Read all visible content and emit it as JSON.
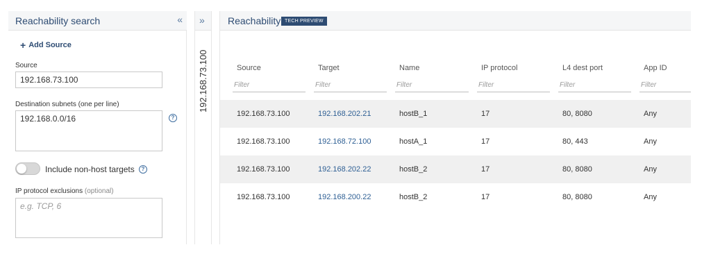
{
  "left_panel": {
    "title": "Reachability search",
    "collapse_icon": "double-chevron-left-icon",
    "add_source_label": "Add Source",
    "source": {
      "label": "Source",
      "value": "192.168.73.100"
    },
    "destination": {
      "label": "Destination subnets (one per line)",
      "value": "192.168.0.0/16"
    },
    "include_non_host": {
      "label": "Include non-host targets",
      "checked": false
    },
    "ip_exclusions": {
      "label": "IP protocol exclusions",
      "optional_label": "(optional)",
      "placeholder": "e.g. TCP, 6"
    }
  },
  "strip": {
    "expand_icon": "double-chevron-right-icon",
    "text": "192.168.73.100"
  },
  "main": {
    "title": "Reachability",
    "badge": "TECH PREVIEW",
    "columns": [
      {
        "label": "Source",
        "filter_placeholder": "Filter"
      },
      {
        "label": "Target",
        "filter_placeholder": "Filter"
      },
      {
        "label": "Name",
        "filter_placeholder": "Filter"
      },
      {
        "label": "IP protocol",
        "filter_placeholder": "Filter"
      },
      {
        "label": "L4 dest port",
        "filter_placeholder": "Filter"
      },
      {
        "label": "App ID",
        "filter_placeholder": "Filter"
      }
    ],
    "rows": [
      [
        "192.168.73.100",
        "192.168.202.21",
        "hostB_1",
        "17",
        "80, 8080",
        "Any"
      ],
      [
        "192.168.73.100",
        "192.168.72.100",
        "hostA_1",
        "17",
        "80, 443",
        "Any"
      ],
      [
        "192.168.73.100",
        "192.168.202.22",
        "hostB_2",
        "17",
        "80, 8080",
        "Any"
      ],
      [
        "192.168.73.100",
        "192.168.200.22",
        "hostB_2",
        "17",
        "80, 8080",
        "Any"
      ]
    ]
  },
  "colors": {
    "accent": "#2e4c73",
    "link": "#2e5f94",
    "row_shade": "#f0f0f0"
  }
}
